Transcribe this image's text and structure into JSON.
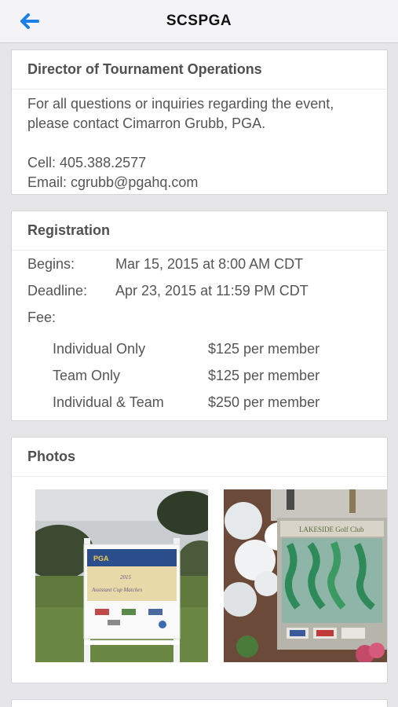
{
  "nav": {
    "title": "SCSPGA",
    "back_icon": "back-arrow-icon"
  },
  "director": {
    "heading": "Director of Tournament Operations",
    "message": "For all questions or inquiries regarding the event, please contact Cimarron Grubb, PGA.",
    "cell": "Cell: 405.388.2577",
    "email": "Email: cgrubb@pgahq.com"
  },
  "registration": {
    "heading": "Registration",
    "begins_label": "Begins:",
    "begins_value": "Mar 15, 2015 at 8:00 AM CDT",
    "deadline_label": "Deadline:",
    "deadline_value": "Apr 23, 2015 at 11:59 PM CDT",
    "fee_label": "Fee:",
    "fees": [
      {
        "type": "Individual Only",
        "price": "$125 per member"
      },
      {
        "type": "Team Only",
        "price": "$125 per member"
      },
      {
        "type": "Individual & Team",
        "price": "$250 per member"
      }
    ]
  },
  "photos": {
    "heading": "Photos",
    "items": [
      {
        "sign_logo": "PGA",
        "sign_year": "2015",
        "sign_text": "Assistant Cup Matches"
      },
      {
        "sign_text": "LAKESIDE Golf Club"
      }
    ]
  },
  "colors": {
    "accent": "#1a7fe6",
    "background": "#e6e6e9",
    "card": "#ffffff"
  }
}
